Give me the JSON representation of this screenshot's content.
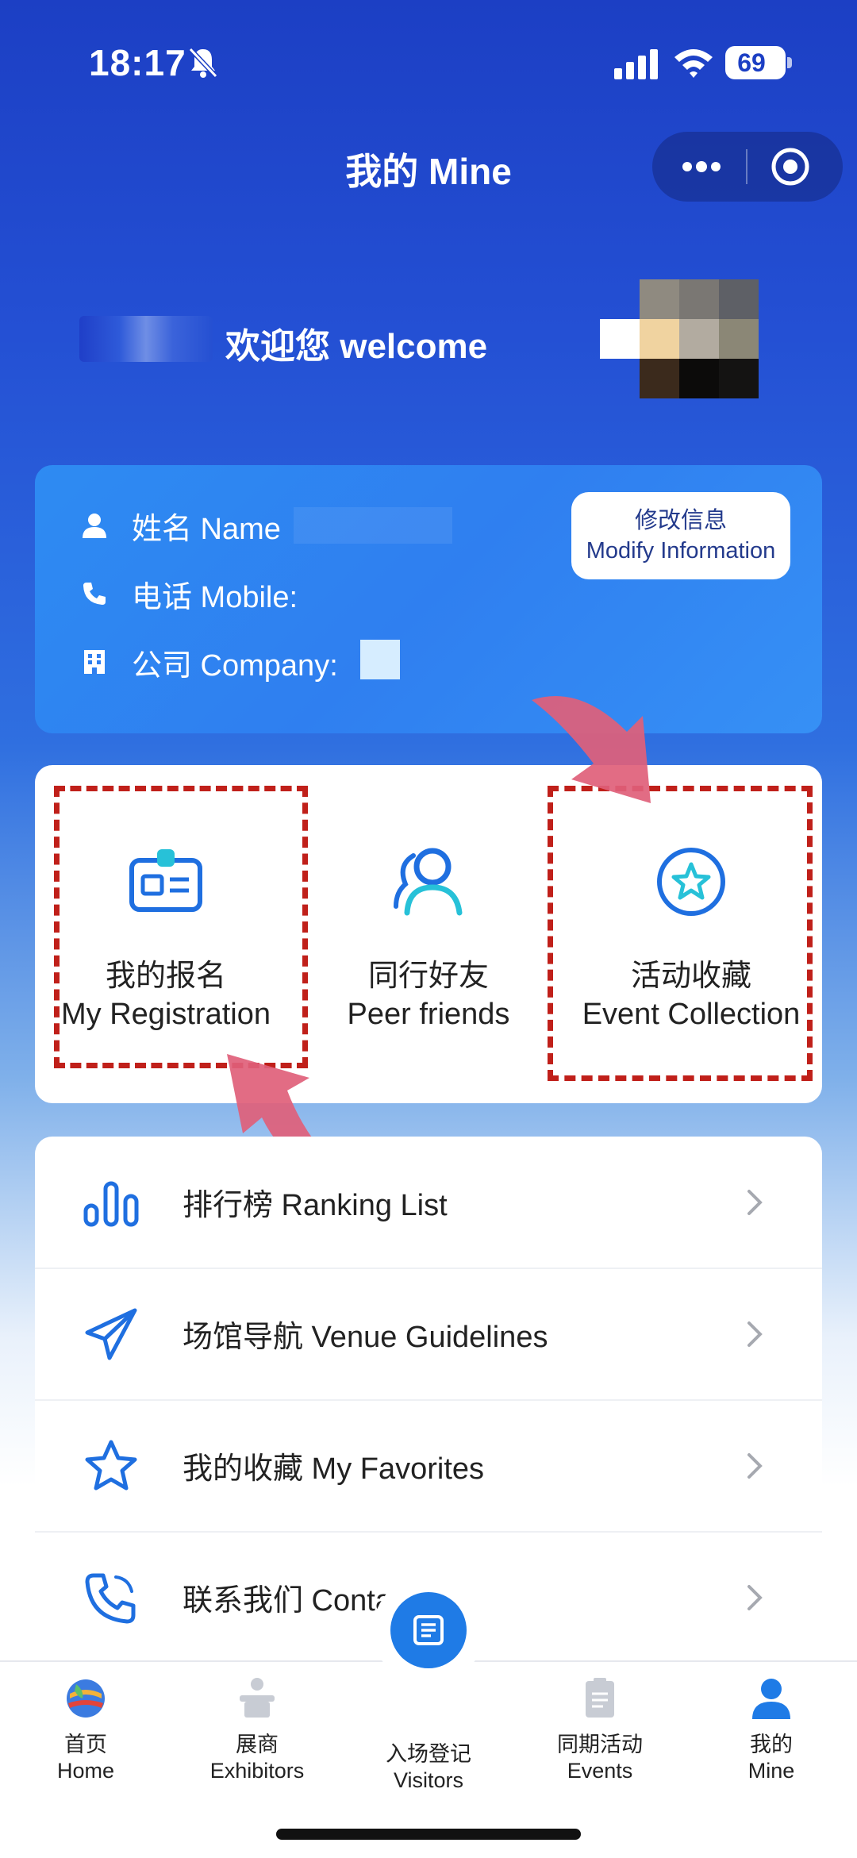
{
  "status_bar": {
    "time": "18:17",
    "battery": "69"
  },
  "nav": {
    "title": "我的 Mine"
  },
  "welcome": {
    "text": "欢迎您 welcome"
  },
  "info_card": {
    "name_label": "姓名 Name",
    "mobile_label": "电话 Mobile:",
    "company_label": "公司 Company:",
    "modify_button": {
      "line1": "修改信息",
      "line2": "Modify Information"
    }
  },
  "grid": [
    {
      "cn": "我的报名",
      "en": "My Registration"
    },
    {
      "cn": "同行好友",
      "en": "Peer friends"
    },
    {
      "cn": "活动收藏",
      "en": "Event Collection"
    }
  ],
  "list": [
    {
      "label": "排行榜 Ranking List",
      "icon": "bar-chart-icon"
    },
    {
      "label": "场馆导航 Venue Guidelines",
      "icon": "paper-plane-icon"
    },
    {
      "label": "我的收藏 My Favorites",
      "icon": "star-icon"
    },
    {
      "label": "联系我们 Contact us",
      "icon": "phone-icon"
    }
  ],
  "tabs": [
    {
      "cn": "首页",
      "en": "Home"
    },
    {
      "cn": "展商",
      "en": "Exhibitors"
    },
    {
      "cn": "入场登记",
      "en": "Visitors"
    },
    {
      "cn": "同期活动",
      "en": "Events"
    },
    {
      "cn": "我的",
      "en": "Mine"
    }
  ],
  "colors": {
    "primary": "#1f6fe0",
    "header_blue": "#1c3fc4",
    "highlight_red": "#c0201a",
    "arrow_pink": "#e0607a"
  }
}
